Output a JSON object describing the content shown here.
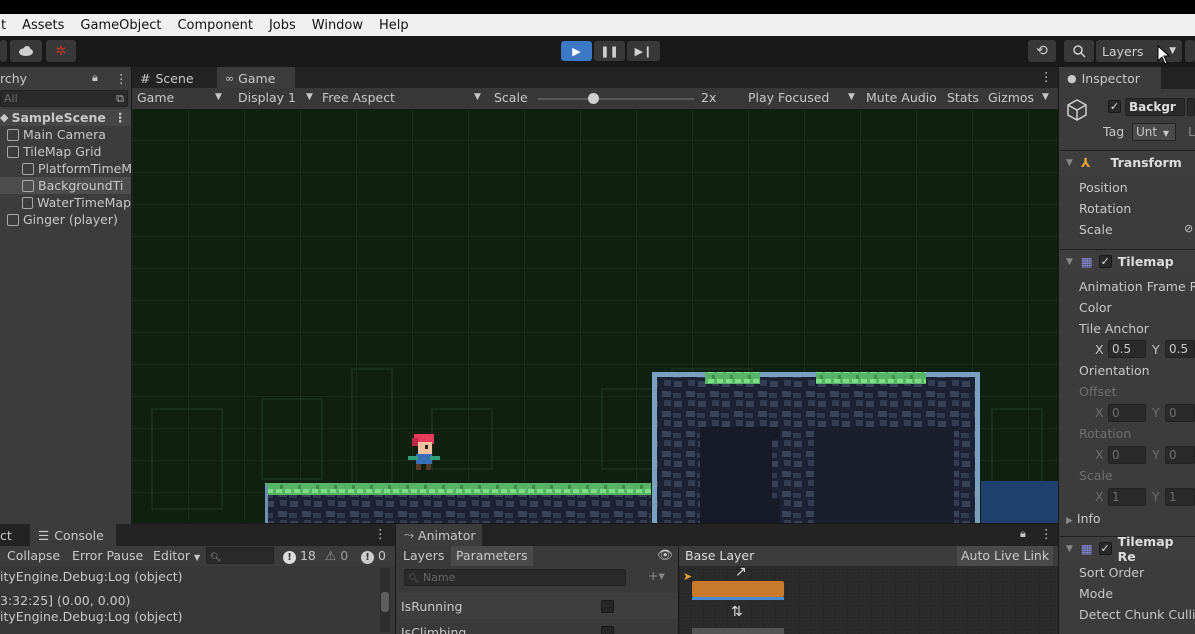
{
  "menu": [
    "t",
    "Assets",
    "GameObject",
    "Component",
    "Jobs",
    "Window",
    "Help"
  ],
  "toolbar": {
    "layers_label": "Layers"
  },
  "hierarchy": {
    "tab_label": "rchy",
    "search_placeholder": "All",
    "scene": "SampleScene",
    "items": [
      "Main Camera",
      "TileMap Grid",
      "PlatformTimeM",
      "BackgroundTi",
      "WaterTimeMap",
      "Ginger (player)"
    ]
  },
  "game": {
    "scene_tab": "Scene",
    "game_tab": "Game",
    "view_select": "Game",
    "display": "Display 1",
    "aspect": "Free Aspect",
    "scale_label": "Scale",
    "scale_value": "2x",
    "play_focused": "Play Focused",
    "mute_audio": "Mute Audio",
    "stats": "Stats",
    "gizmos": "Gizmos"
  },
  "inspector": {
    "tab_label": "Inspector",
    "object_name": "Backgr",
    "tag_label": "Tag",
    "tag_value": "Unt",
    "transform_title": "Transform",
    "position": "Position",
    "rotation": "Rotation",
    "scale": "Scale",
    "tilemap_title": "Tilemap",
    "anim_frame_rate": "Animation Frame Ra",
    "color": "Color",
    "tile_anchor": "Tile Anchor",
    "anchor_x_label": "X",
    "anchor_x": "0.5",
    "anchor_y_label": "Y",
    "anchor_y": "0.5",
    "orientation": "Orientation",
    "offset": "Offset",
    "offset_x": "0",
    "offset_y": "0",
    "rot_label": "Rotation",
    "rot_x": "0",
    "rot_y": "0",
    "scale_label": "Scale",
    "scale_x": "1",
    "scale_y": "1",
    "info": "Info",
    "renderer_title": "Tilemap Re",
    "sort_order": "Sort Order",
    "mode": "Mode",
    "detect_chunk": "Detect Chunk Culli"
  },
  "console": {
    "project_tab": "ct",
    "console_tab": "Console",
    "collapse": "Collapse",
    "error_pause": "Error Pause",
    "editor": "Editor",
    "log_count": "18",
    "warn_count": "0",
    "error_count": "0",
    "lines": [
      "ityEngine.Debug:Log (object)",
      "3:32:25] (0.00, 0.00)",
      "ityEngine.Debug:Log (object)"
    ]
  },
  "animator": {
    "tab_label": "Animator",
    "layers_tab": "Layers",
    "parameters_tab": "Parameters",
    "name_placeholder": "Name",
    "params": [
      "IsRunning",
      "IsClimbing"
    ],
    "base_layer": "Base Layer",
    "auto_live_link": "Auto Live Link"
  },
  "colors": {
    "play_blue": "#3b79c6",
    "grass": "#6fd07a",
    "water": "#1f3f6e"
  }
}
